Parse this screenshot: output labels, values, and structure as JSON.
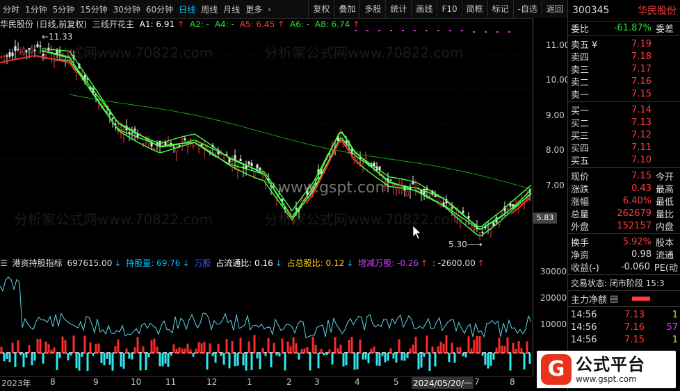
{
  "toolbar": {
    "timeframes": [
      "分时",
      "1分钟",
      "5分钟",
      "15分钟",
      "30分钟",
      "60分钟",
      "日线",
      "周线",
      "月线",
      "更多"
    ],
    "active_timeframe": "日线",
    "buttons": [
      "复权",
      "叠加",
      "多股",
      "统计",
      "画线",
      "F10",
      "简框",
      "标记",
      "-自选",
      "返回"
    ]
  },
  "main_title": {
    "stock": "华民股份 (日线,前复权)",
    "indicator": "三线开花主",
    "a1": "A1: 6.91",
    "a2": "A2: -",
    "a4": "A4: -",
    "a5": "A5: 6.45",
    "a6": "A6: -",
    "a8": "A8: 6.74",
    "high_label": "11.33",
    "low_label": "5.30"
  },
  "price_axis": [
    "11.00",
    "10.00",
    "9.00",
    "8.00",
    "7.00"
  ],
  "last_price_tag": "5.83",
  "indicator_title": {
    "name": "港资持股指标",
    "v1": "697615.00",
    "hold_label": "持股量: 69.76",
    "wan": "万股",
    "float_ratio": "占流通比: 0.16",
    "total_ratio": "占总股比: 0.12",
    "change": "增减万股: -0.26",
    "last": ": -2600.00"
  },
  "indicator_axis": [
    "30000",
    "20000",
    "10000"
  ],
  "date_axis": [
    "2023年",
    "8",
    "9",
    "10",
    "11",
    "12",
    "1",
    "2",
    "3",
    "4",
    "5",
    "2024/05/20/一",
    "7",
    "8"
  ],
  "quote": {
    "code": "300345",
    "name": "华民股份",
    "webi_label": "委比",
    "webi_value": "-61.87%",
    "weicha_label": "委差",
    "asks": [
      {
        "label": "卖五 ¥",
        "price": "7.19"
      },
      {
        "label": "卖四",
        "price": "7.18"
      },
      {
        "label": "卖三",
        "price": "7.17"
      },
      {
        "label": "卖二",
        "price": "7.16"
      },
      {
        "label": "卖一",
        "price": "7.15"
      }
    ],
    "bids": [
      {
        "label": "买一",
        "price": "7.14"
      },
      {
        "label": "买二",
        "price": "7.13"
      },
      {
        "label": "买三",
        "price": "7.12"
      },
      {
        "label": "买四",
        "price": "7.11"
      },
      {
        "label": "买五",
        "price": "7.10"
      }
    ],
    "stats": [
      {
        "k": "现价",
        "v": "7.15",
        "k2": "今开"
      },
      {
        "k": "涨跌",
        "v": "0.43",
        "k2": "最高"
      },
      {
        "k": "涨幅",
        "v": "6.40%",
        "k2": "最低"
      },
      {
        "k": "总量",
        "v": "262679",
        "k2": "量比"
      },
      {
        "k": "外盘",
        "v": "152157",
        "k2": "内盘"
      }
    ],
    "stats2": [
      {
        "k": "换手",
        "v": "5.92%",
        "k2": "股本"
      },
      {
        "k": "净资",
        "v": "0.98",
        "k2": "流通"
      },
      {
        "k": "收益(-)",
        "v": "-0.060",
        "k2": "PE(动"
      }
    ],
    "status_label": "交易状态: 闭市阶段 15:3",
    "net_label": "主力净额",
    "ticks": [
      {
        "t": "14:56",
        "p": "7.13",
        "v": "1"
      },
      {
        "t": "14:56",
        "p": "7.16",
        "v": "57"
      },
      {
        "t": "14:56",
        "p": "7.15",
        "v": "1"
      }
    ]
  },
  "logo": {
    "mark": "G",
    "line1": "公式平台",
    "line2": "www.gspt.com"
  },
  "watermark": {
    "text": "分析家公式网www.70822.com",
    "site": "www.gspt.com"
  }
}
